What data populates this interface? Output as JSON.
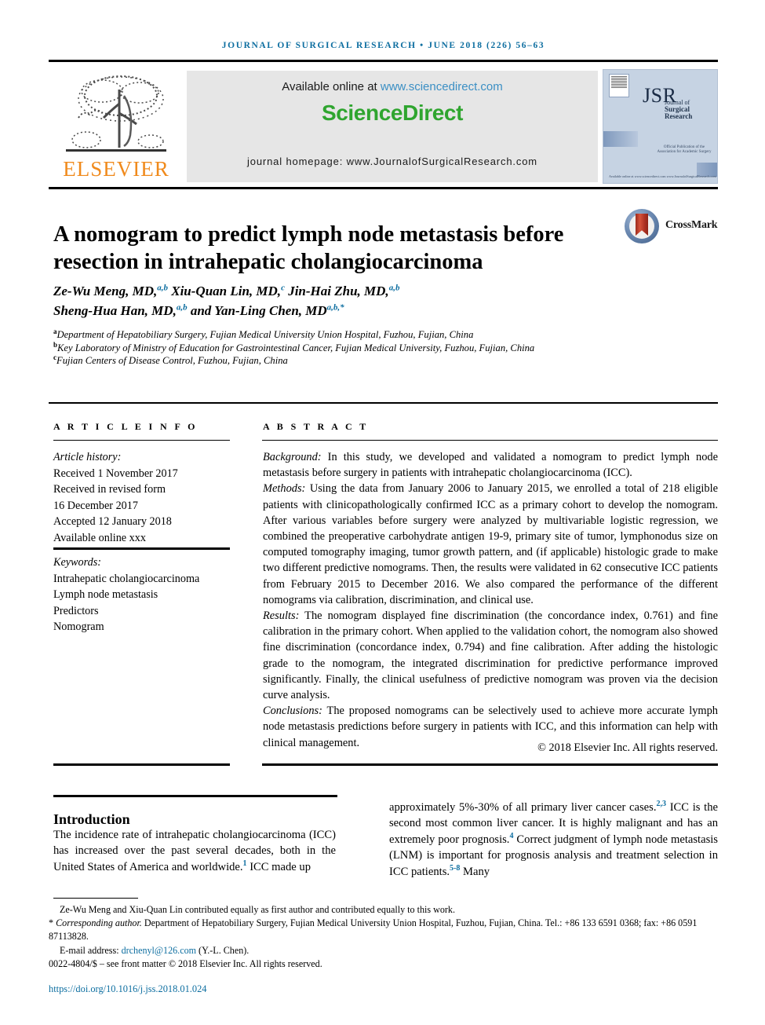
{
  "running_head": "JOURNAL OF SURGICAL RESEARCH • JUNE 2018 (226) 56–63",
  "masthead": {
    "publisher_name": "ELSEVIER",
    "available_text": "Available online at ",
    "available_url": "www.sciencedirect.com",
    "brand": "ScienceDirect",
    "homepage": "journal homepage: www.JournalofSurgicalResearch.com",
    "cover": {
      "acronym": "JSR",
      "line1": "Journal of",
      "line2": "Surgical Research",
      "footer": "Official Publication of the Association for Academic Surgery",
      "url": "Available online at www.sciencedirect.com www.JournalofSurgicalResearch.com"
    }
  },
  "crossmark": {
    "label": "CrossMark"
  },
  "article": {
    "title": "A nomogram to predict lymph node metastasis before resection in intrahepatic cholangiocarcinoma",
    "authors_line1_parts": [
      {
        "t": "Ze-Wu Meng, MD,",
        "sup": "a,b"
      },
      {
        "t": " Xiu-Quan Lin, MD,",
        "sup": "c"
      },
      {
        "t": " Jin-Hai Zhu, MD,",
        "sup": "a,b"
      }
    ],
    "authors_line2_parts": [
      {
        "t": "Sheng-Hua Han, MD,",
        "sup": "a,b"
      },
      {
        "t": " and Yan-Ling Chen, MD",
        "sup": "a,b,*"
      }
    ],
    "affiliations": [
      {
        "mark": "a",
        "text": "Department of Hepatobiliary Surgery, Fujian Medical University Union Hospital, Fuzhou, Fujian, China"
      },
      {
        "mark": "b",
        "text": "Key Laboratory of Ministry of Education for Gastrointestinal Cancer, Fujian Medical University, Fuzhou, Fujian, China"
      },
      {
        "mark": "c",
        "text": "Fujian Centers of Disease Control, Fuzhou, Fujian, China"
      }
    ]
  },
  "article_info": {
    "header": "A R T I C L E   I N F O",
    "history_label": "Article history:",
    "history": [
      "Received 1 November 2017",
      "Received in revised form",
      "16 December 2017",
      "Accepted 12 January 2018",
      "Available online xxx"
    ],
    "keywords_label": "Keywords:",
    "keywords": [
      "Intrahepatic cholangiocarcinoma",
      "Lymph node metastasis",
      "Predictors",
      "Nomogram"
    ]
  },
  "abstract": {
    "header": "A B S T R A C T",
    "sections": [
      {
        "lead": "Background:",
        "text": " In this study, we developed and validated a nomogram to predict lymph node metastasis before surgery in patients with intrahepatic cholangiocarcinoma (ICC)."
      },
      {
        "lead": "Methods:",
        "text": " Using the data from January 2006 to January 2015, we enrolled a total of 218 eligible patients with clinicopathologically confirmed ICC as a primary cohort to develop the nomogram. After various variables before surgery were analyzed by multivariable logistic regression, we combined the preoperative carbohydrate antigen 19-9, primary site of tumor, lymphonodus size on computed tomography imaging, tumor growth pattern, and (if applicable) histologic grade to make two different predictive nomograms. Then, the results were validated in 62 consecutive ICC patients from February 2015 to December 2016. We also compared the performance of the different nomograms via calibration, discrimination, and clinical use."
      },
      {
        "lead": "Results:",
        "text": " The nomogram displayed fine discrimination (the concordance index, 0.761) and fine calibration in the primary cohort. When applied to the validation cohort, the nomogram also showed fine discrimination (concordance index, 0.794) and fine calibration. After adding the histologic grade to the nomogram, the integrated discrimination for predictive performance improved significantly. Finally, the clinical usefulness of predictive nomogram was proven via the decision curve analysis."
      },
      {
        "lead": "Conclusions:",
        "text": " The proposed nomograms can be selectively used to achieve more accurate lymph node metastasis predictions before surgery in patients with ICC, and this information can help with clinical management."
      }
    ],
    "copyright": "© 2018 Elsevier Inc. All rights reserved."
  },
  "body": {
    "intro_heading": "Introduction",
    "left_column": "The incidence rate of intrahepatic cholangiocarcinoma (ICC) has increased over the past several decades, both in the United States of America and worldwide.",
    "left_ref": "1",
    "left_column_tail": " ICC made up",
    "right_column_a": "approximately 5%-30% of all primary liver cancer cases.",
    "right_ref_a": "2,3",
    "right_column_b": " ICC is the second most common liver cancer. It is highly malignant and has an extremely poor prognosis.",
    "right_ref_b": "4",
    "right_column_c": " Correct judgment of lymph node metastasis (LNM) is important for prognosis analysis and treatment selection in ICC patients.",
    "right_ref_c": "5-8",
    "right_column_d": " Many"
  },
  "footnotes": {
    "equal_contrib": "Ze-Wu Meng and Xiu-Quan Lin contributed equally as first author and contributed equally to this work.",
    "corresponding_marker": "*",
    "corresponding_label": "Corresponding author.",
    "corresponding_text": " Department of Hepatobiliary Surgery, Fujian Medical University Union Hospital, Fuzhou, Fujian, China. Tel.: +86 133 6591 0368; fax: +86 0591 87113828.",
    "email_label": "E-mail address:",
    "email": "drchenyl@126.com",
    "email_attrib": " (Y.-L. Chen).",
    "issn_line": "0022-4804/$ – see front matter © 2018 Elsevier Inc. All rights reserved.",
    "doi": "https://doi.org/10.1016/j.jss.2018.01.024"
  },
  "colors": {
    "link_blue": "#0d6ea0",
    "sd_green": "#2fa52f",
    "sd_link": "#3b8fc4",
    "elsevier_orange": "#f08a1c",
    "banner_gray": "#e6e6e6"
  }
}
